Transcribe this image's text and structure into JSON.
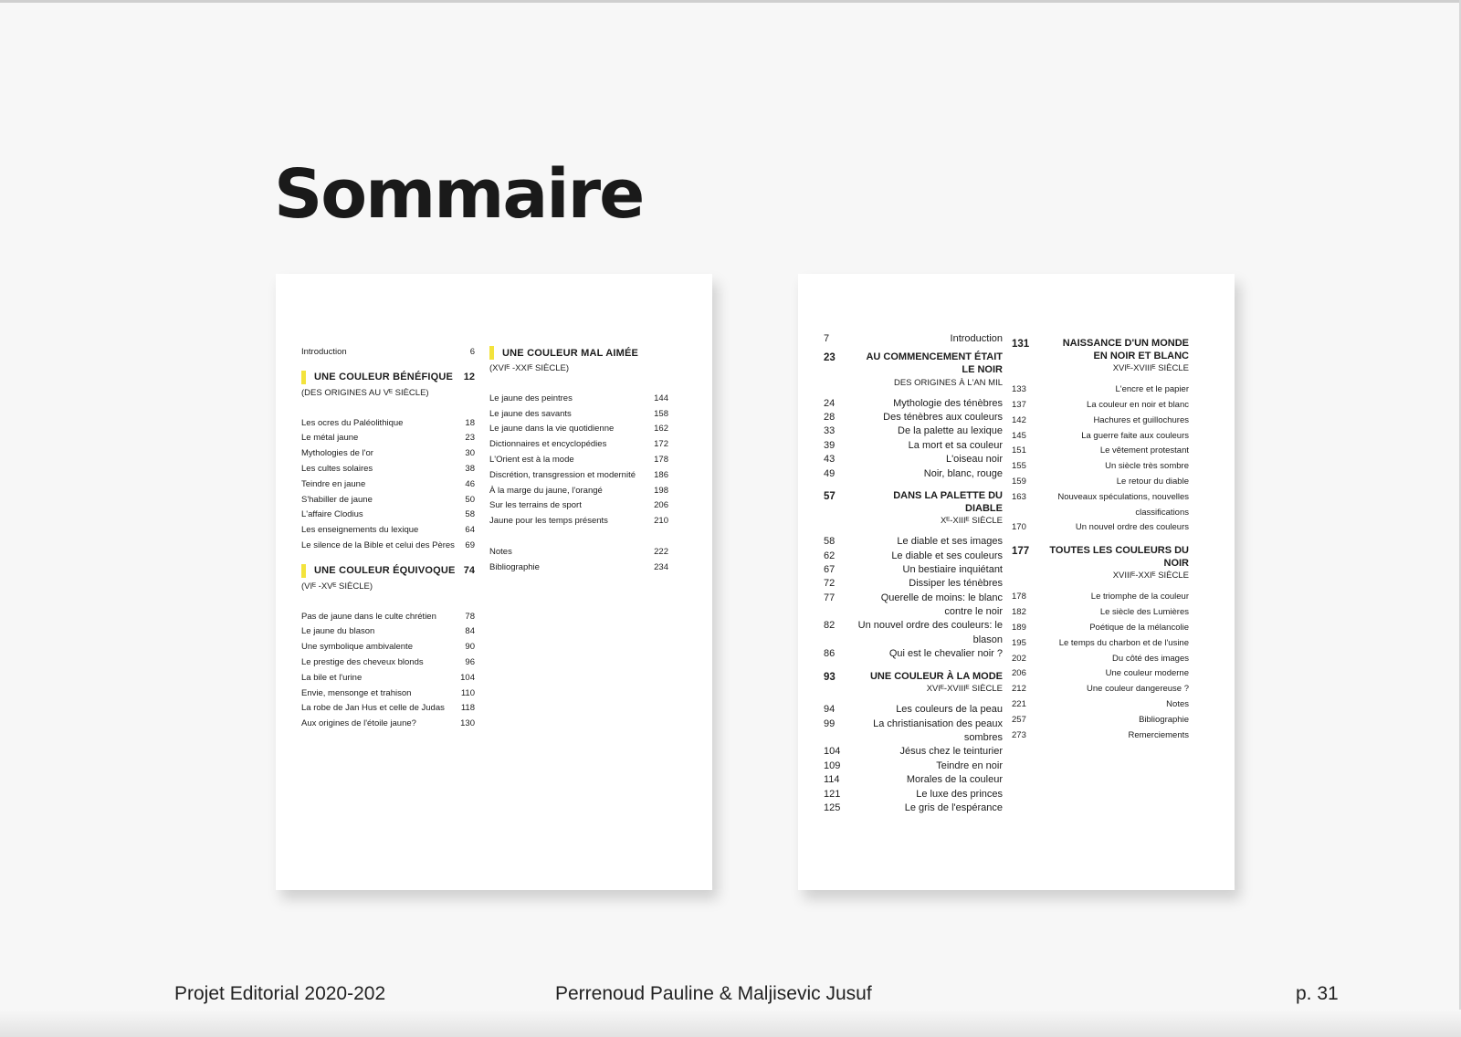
{
  "header": {
    "title": "Sommaire"
  },
  "left_page": {
    "col1": {
      "intro": {
        "label": "Introduction",
        "page": "6"
      },
      "sections": [
        {
          "title": "UNE COULEUR BÉNÉFIQUE",
          "page": "12",
          "subtitle": "(DES ORIGINES AU Vᴱ SIÈCLE)",
          "items": [
            {
              "label": "Les ocres du Paléolithique",
              "page": "18"
            },
            {
              "label": "Le métal jaune",
              "page": "23"
            },
            {
              "label": "Mythologies de l'or",
              "page": "30"
            },
            {
              "label": "Les cultes solaires",
              "page": "38"
            },
            {
              "label": "Teindre en jaune",
              "page": "46"
            },
            {
              "label": "S'habiller de jaune",
              "page": "50"
            },
            {
              "label": "L'affaire Clodius",
              "page": "58"
            },
            {
              "label": "Les enseignements du lexique",
              "page": "64"
            },
            {
              "label": "Le silence de la Bible et celui des Pères",
              "page": "69"
            }
          ]
        },
        {
          "title": "UNE COULEUR ÉQUIVOQUE",
          "page": "74",
          "subtitle": "(VIᴱ -XVᴱ SIÈCLE)",
          "items": [
            {
              "label": "Pas de jaune dans le culte chrétien",
              "page": "78"
            },
            {
              "label": "Le jaune du blason",
              "page": "84"
            },
            {
              "label": "Une symbolique ambivalente",
              "page": "90"
            },
            {
              "label": "Le prestige des cheveux blonds",
              "page": "96"
            },
            {
              "label": "La bile et l'urine",
              "page": "104"
            },
            {
              "label": "Envie, mensonge et trahison",
              "page": "110"
            },
            {
              "label": "La robe de Jan Hus et celle de Judas",
              "page": "118"
            },
            {
              "label": "Aux origines de l'étoile jaune?",
              "page": "130"
            }
          ]
        }
      ]
    },
    "col2": {
      "section": {
        "title": "UNE COULEUR MAL AIMÉE",
        "subtitle": "(XVIᴱ -XXIᴱ SIÈCLE)",
        "items": [
          {
            "label": "Le jaune des peintres",
            "page": "144"
          },
          {
            "label": "Le jaune des savants",
            "page": "158"
          },
          {
            "label": "Le jaune dans la vie quotidienne",
            "page": "162"
          },
          {
            "label": "Dictionnaires et encyclopédies",
            "page": "172"
          },
          {
            "label": "L'Orient est à la mode",
            "page": "178"
          },
          {
            "label": "Discrétion, transgression et modernité",
            "page": "186"
          },
          {
            "label": "À la marge du jaune, l'orangé",
            "page": "198"
          },
          {
            "label": "Sur les terrains de sport",
            "page": "206"
          },
          {
            "label": "Jaune pour les temps présents",
            "page": "210"
          }
        ]
      },
      "end_items": [
        {
          "label": "Notes",
          "page": "222"
        },
        {
          "label": "Bibliographie",
          "page": "234"
        }
      ]
    }
  },
  "right_page": {
    "col1": {
      "intro": {
        "page": "7",
        "label": "Introduction"
      },
      "sections": [
        {
          "page": "23",
          "title_lines": [
            "AU COMMENCEMENT ÉTAIT",
            "LE NOIR"
          ],
          "subtitle": "DES ORIGINES À L'AN MIL",
          "items": [
            {
              "page": "24",
              "label": "Mythologie des ténèbres"
            },
            {
              "page": "28",
              "label": "Des ténèbres aux couleurs"
            },
            {
              "page": "33",
              "label": "De la palette au lexique"
            },
            {
              "page": "39",
              "label": "La mort et sa couleur"
            },
            {
              "page": "43",
              "label": "L'oiseau noir"
            },
            {
              "page": "49",
              "label": "Noir, blanc, rouge"
            }
          ]
        },
        {
          "page": "57",
          "title_lines": [
            "DANS LA PALETTE DU DIABLE"
          ],
          "subtitle": "Xᴱ-XIIIᴱ SIÈCLE",
          "items": [
            {
              "page": "58",
              "label": "Le diable et ses images"
            },
            {
              "page": "62",
              "label": "Le diable et ses couleurs"
            },
            {
              "page": "67",
              "label": "Un bestiaire inquiétant"
            },
            {
              "page": "72",
              "label": "Dissiper les ténèbres"
            },
            {
              "page": "77",
              "label": "Querelle de moins: le blanc contre le noir"
            },
            {
              "page": "82",
              "label": "Un nouvel ordre des couleurs: le blason"
            },
            {
              "page": "86",
              "label": "Qui est le chevalier noir ?"
            }
          ]
        },
        {
          "page": "93",
          "title_lines": [
            "UNE COULEUR À LA MODE"
          ],
          "subtitle": "XVIᴱ-XVIIIᴱ SIÈCLE",
          "items": [
            {
              "page": "94",
              "label": "Les couleurs de la peau"
            },
            {
              "page": "99",
              "label": "La christianisation des peaux sombres"
            },
            {
              "page": "104",
              "label": "Jésus chez le teinturier"
            },
            {
              "page": "109",
              "label": "Teindre en noir"
            },
            {
              "page": "114",
              "label": "Morales de la couleur"
            },
            {
              "page": "121",
              "label": "Le luxe des princes"
            },
            {
              "page": "125",
              "label": "Le gris de l'espérance"
            }
          ]
        }
      ]
    },
    "col2": {
      "sections": [
        {
          "page": "131",
          "title_lines": [
            "NAISSANCE D'UN MONDE",
            "EN NOIR ET BLANC"
          ],
          "subtitle": "XVIᴱ-XVIIIᴱ SIÈCLE",
          "items": [
            {
              "page": "133",
              "label": "L'encre et le papier"
            },
            {
              "page": "137",
              "label": "La couleur en noir et blanc"
            },
            {
              "page": "142",
              "label": "Hachures et guillochures"
            },
            {
              "page": "145",
              "label": "La guerre faite aux couleurs"
            },
            {
              "page": "151",
              "label": "Le vêtement protestant"
            },
            {
              "page": "155",
              "label": "Un siècle très sombre"
            },
            {
              "page": "159",
              "label": "Le retour du diable"
            },
            {
              "page": "163",
              "label": "Nouveaux spéculations, nouvelles classifications"
            },
            {
              "page": "170",
              "label": "Un nouvel ordre des couleurs"
            }
          ]
        },
        {
          "page": "177",
          "title_lines": [
            "TOUTES LES COULEURS DU",
            "NOIR"
          ],
          "subtitle": "XVIIIᴱ-XXIᴱ SIÈCLE",
          "items": [
            {
              "page": "178",
              "label": "Le triomphe de la couleur"
            },
            {
              "page": "182",
              "label": "Le siècle des Lumières"
            },
            {
              "page": "189",
              "label": "Poétique de la mélancolie"
            },
            {
              "page": "195",
              "label": "Le temps du charbon et de l'usine"
            },
            {
              "page": "202",
              "label": "Du côté des images"
            },
            {
              "page": "206",
              "label": "Une couleur moderne"
            },
            {
              "page": "212",
              "label": "Une couleur dangereuse ?"
            },
            {
              "page": "221",
              "label": "Notes"
            },
            {
              "page": "257",
              "label": "Bibliographie"
            },
            {
              "page": "273",
              "label": "Remerciements"
            }
          ]
        }
      ]
    }
  },
  "footer": {
    "project": "Projet Editorial 2020-202",
    "authors": "Perrenoud Pauline & Maljisevic Jusuf",
    "page_number": "p. 31"
  },
  "colors": {
    "accent_bar": "#f3e33c",
    "text": "#1c1c1c",
    "background": "#f7f7f7"
  }
}
